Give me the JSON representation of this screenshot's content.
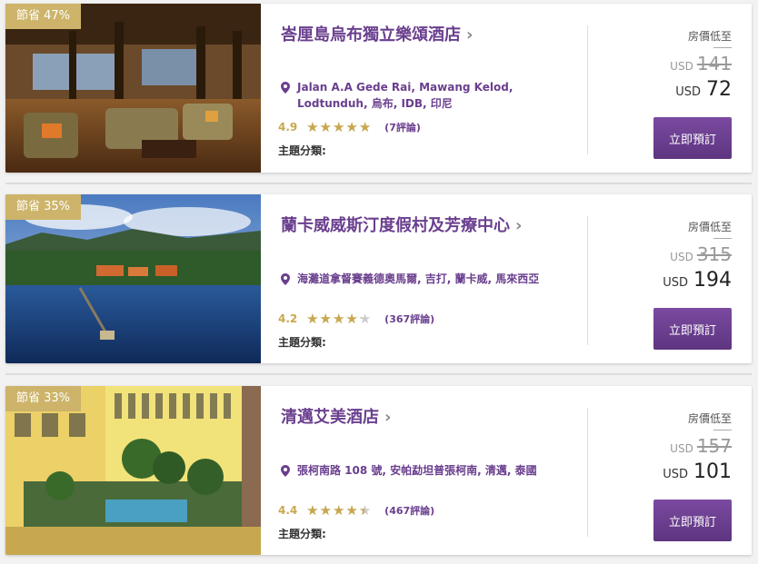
{
  "hotels": [
    {
      "discount": "節省 47%",
      "name": "峇厘島烏布獨立樂頌酒店",
      "address": "Jalan A.A Gede Rai, Mawang Kelod, Lodtunduh, 烏布, IDB, 印尼",
      "score": "4.9",
      "stars": 4.9,
      "reviews": "(7評論)",
      "theme_label": "主題分類:",
      "price_label": "房價低至",
      "currency": "USD",
      "original_price": "141",
      "price": "72",
      "book_label": "立即預訂"
    },
    {
      "discount": "節省 35%",
      "name": "蘭卡威威斯汀度假村及芳療中心",
      "address": "海灘道拿督賽義德奧馬爾, 吉打, 蘭卡威, 馬來西亞",
      "score": "4.2",
      "stars": 4.2,
      "reviews": "(367評論)",
      "theme_label": "主題分類:",
      "price_label": "房價低至",
      "currency": "USD",
      "original_price": "315",
      "price": "194",
      "book_label": "立即預訂"
    },
    {
      "discount": "節省 33%",
      "name": "清邁艾美酒店",
      "address": "張柯南路 108 號, 安帕勐坦普張柯南, 清邁, 泰國",
      "score": "4.4",
      "stars": 4.4,
      "reviews": "(467評論)",
      "theme_label": "主題分類:",
      "price_label": "房價低至",
      "currency": "USD",
      "original_price": "157",
      "price": "101",
      "book_label": "立即預訂"
    }
  ],
  "colors": {
    "brand": "#6a3f8e",
    "gold": "#c8a84e",
    "badge": "#cdb46a"
  },
  "icons": {
    "location": "map-pin-icon",
    "chevron": "chevron-right-icon",
    "star": "star-icon"
  }
}
